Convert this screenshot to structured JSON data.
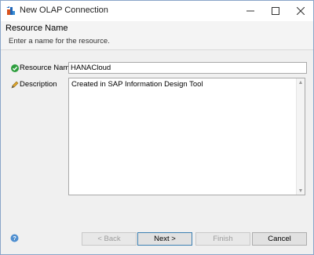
{
  "window": {
    "title": "New OLAP Connection",
    "icons": {
      "app": "olap-connection-icon",
      "minimize": "minimize-icon",
      "maximize": "maximize-icon",
      "close": "close-icon"
    }
  },
  "banner": {
    "title": "Resource Name",
    "subtitle": "Enter a name for the resource."
  },
  "form": {
    "name_label": "Resource Name",
    "name_value": "HANACloud",
    "name_status_icon": "check-circle-icon",
    "description_label": "Description",
    "description_icon": "pencil-icon",
    "description_value": "Created in SAP Information Design Tool"
  },
  "footer": {
    "help_icon": "help-icon",
    "back_label": "< Back",
    "next_label": "Next >",
    "finish_label": "Finish",
    "cancel_label": "Cancel"
  },
  "colors": {
    "accent": "#3c7fb1",
    "success": "#2e9e3e",
    "dialog_bg": "#f0f0f0",
    "banner_bg": "#f4f4f4",
    "disabled_text": "#9c9c9c"
  }
}
